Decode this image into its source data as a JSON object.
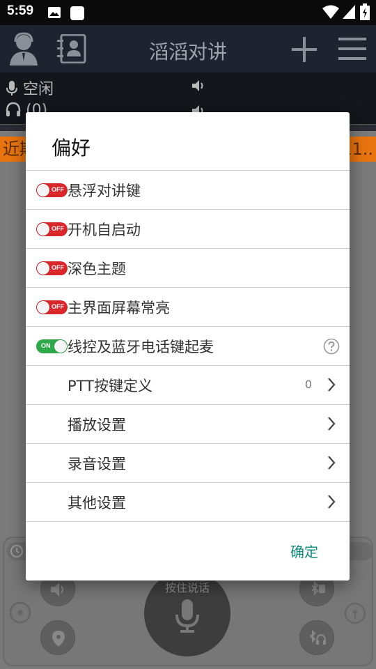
{
  "status_bar": {
    "time": "5:59"
  },
  "app_bar": {
    "title": "滔滔对讲"
  },
  "status_rows": {
    "mic_status": "空闲",
    "headset_status": "(0)"
  },
  "recent_bar": {
    "left_text": "近期",
    "right_text": "11.."
  },
  "ptt": {
    "label": "按住说话"
  },
  "dialog": {
    "title": "偏好",
    "toggles": [
      {
        "label": "悬浮对讲键",
        "state": "OFF"
      },
      {
        "label": "开机自启动",
        "state": "OFF"
      },
      {
        "label": "深色主题",
        "state": "OFF"
      },
      {
        "label": "主界面屏幕常亮",
        "state": "OFF"
      },
      {
        "label": "线控及蓝牙电话键起麦",
        "state": "ON"
      }
    ],
    "items": [
      {
        "label": "PTT按键定义",
        "value": "0"
      },
      {
        "label": "播放设置",
        "value": ""
      },
      {
        "label": "录音设置",
        "value": ""
      },
      {
        "label": "其他设置",
        "value": ""
      }
    ],
    "ok_label": "确定"
  },
  "colors": {
    "accent": "#118a7e",
    "toggle_off": "#d8262a",
    "toggle_on": "#2fa84a",
    "recent_bar": "#e8740f"
  },
  "icons": [
    "image-icon",
    "sim-icon",
    "wifi-icon",
    "battery-icon",
    "avatar-icon",
    "contacts-icon",
    "add-icon",
    "menu-icon",
    "mic-icon",
    "headset-icon",
    "volume-icon",
    "help-icon",
    "chevron-right-icon"
  ]
}
